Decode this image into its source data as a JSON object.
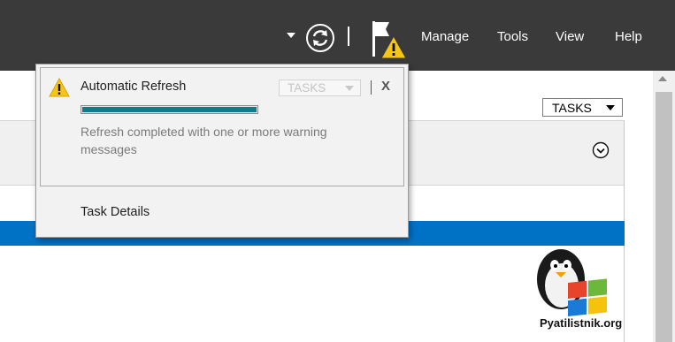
{
  "toolbar": {
    "menu": [
      {
        "label": "Manage"
      },
      {
        "label": "Tools"
      },
      {
        "label": "View"
      },
      {
        "label": "Help"
      }
    ],
    "icons": [
      "refresh-icon",
      "flag-warning-icon"
    ]
  },
  "panel": {
    "tasks_label": "TASKS"
  },
  "notification": {
    "title": "Automatic Refresh",
    "tasks_label": "TASKS",
    "close_label": "X",
    "progress": 1.0,
    "message": "Refresh completed with one or more warning messages",
    "task_details_label": "Task Details"
  },
  "watermark": {
    "text": "Pyatilistnik.org"
  },
  "colors": {
    "topbar": "#3a3a3a",
    "accent_blue": "#0072c6",
    "progress": "#0f7b8c",
    "warning": "#f5c518"
  }
}
